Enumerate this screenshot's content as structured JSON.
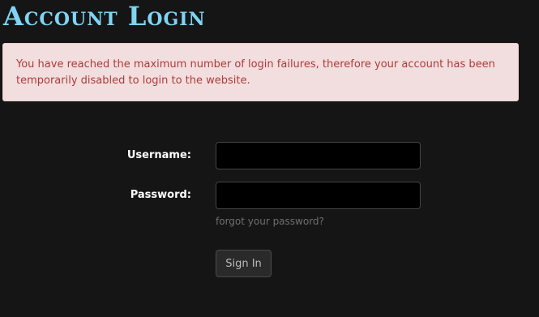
{
  "page": {
    "title": "Account Login"
  },
  "alert": {
    "message": "You have reached the maximum number of login failures, therefore your account has been temporarily disabled to login to the website."
  },
  "form": {
    "username_label": "Username:",
    "username_value": "",
    "password_label": "Password:",
    "password_value": "",
    "forgot_link": "forgot your password?",
    "signin_label": "Sign In"
  },
  "colors": {
    "background": "#151515",
    "title": "#7fd4f4",
    "alert_background": "#f2dede",
    "alert_text": "#b03a3a"
  }
}
